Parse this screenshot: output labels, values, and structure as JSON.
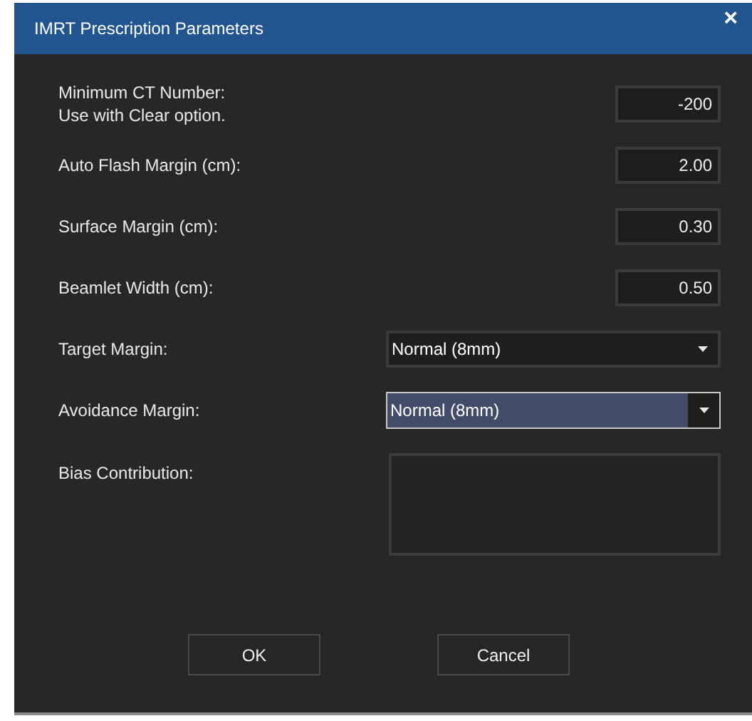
{
  "window": {
    "title": "IMRT Prescription Parameters",
    "close": "×"
  },
  "fields": [
    {
      "kind": "number",
      "label": "Minimum CT Number:\nUse with Clear option.",
      "value": "-200"
    },
    {
      "kind": "number",
      "label": "Auto Flash Margin (cm):",
      "value": "2.00"
    },
    {
      "kind": "number",
      "label": "Surface Margin (cm):",
      "value": "0.30"
    },
    {
      "kind": "number",
      "label": "Beamlet Width (cm):",
      "value": "0.50"
    },
    {
      "kind": "dropdown",
      "label": "Target Margin:",
      "value": "Normal (8mm)",
      "focused": false
    },
    {
      "kind": "dropdown",
      "label": "Avoidance Margin:",
      "value": "Normal (8mm)",
      "focused": true
    },
    {
      "kind": "textarea",
      "label": "Bias Contribution:"
    }
  ],
  "buttons": [
    "OK",
    "Cancel"
  ]
}
